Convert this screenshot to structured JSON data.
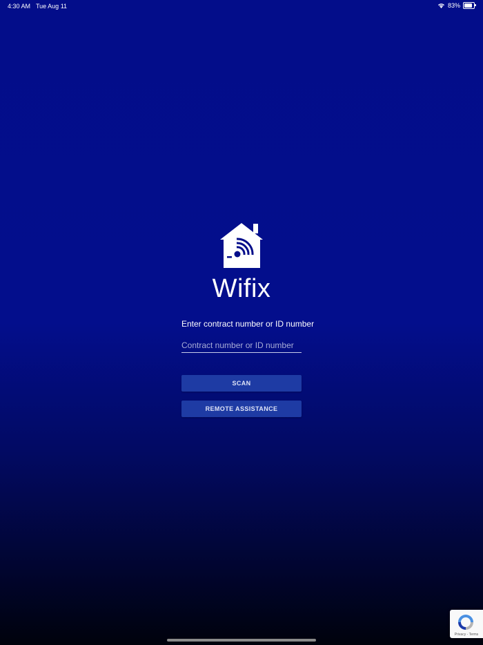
{
  "status_bar": {
    "time": "4:30 AM",
    "date": "Tue Aug 11",
    "battery_text": "83%",
    "battery_level": 0.83
  },
  "app": {
    "name": "Wifix",
    "logo_icon": "house-wifi-icon"
  },
  "form": {
    "prompt": "Enter contract number or ID number",
    "input_value": "",
    "input_placeholder": "Contract number or ID number"
  },
  "buttons": {
    "scan": "SCAN",
    "remote_assistance": "REMOTE ASSISTANCE"
  },
  "recaptcha": {
    "privacy": "Privacy",
    "separator": " - ",
    "terms": "Terms"
  },
  "colors": {
    "background_top": "#030d8a",
    "background_bottom": "#00020c",
    "button": "#1e3ba4"
  }
}
